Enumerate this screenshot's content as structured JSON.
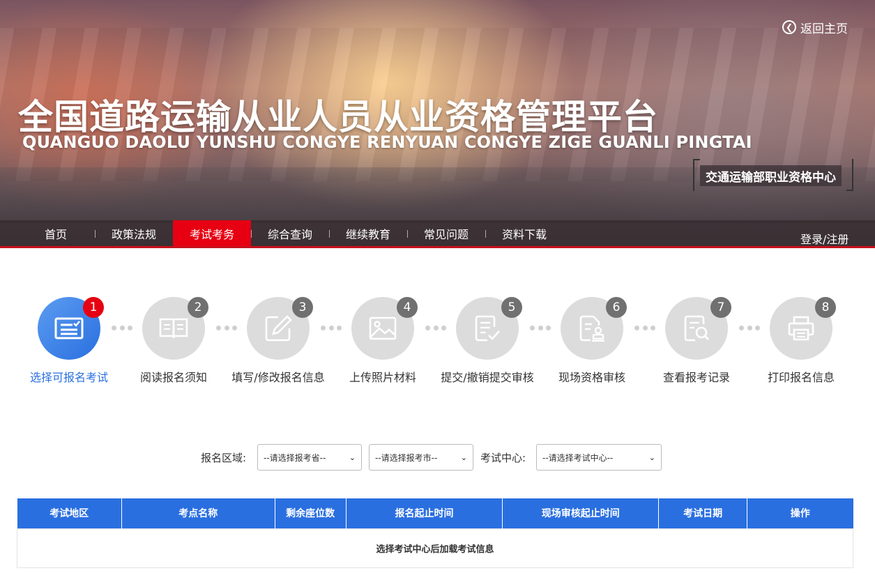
{
  "header": {
    "home_link": "返回主页",
    "title_cn": "全国道路运输从业人员从业资格管理平台",
    "title_en": "QUANGUO DAOLU YUNSHU CONGYE RENYUAN CONGYE ZIGE GUANLI PINGTAI",
    "org": "交通运输部职业资格中心"
  },
  "nav": {
    "items": [
      "首页",
      "政策法规",
      "考试考务",
      "综合查询",
      "继续教育",
      "常见问题",
      "资料下载"
    ],
    "active_index": 2,
    "login": "登录/注册"
  },
  "steps": [
    {
      "num": "1",
      "label": "选择可报名考试",
      "icon": "exam-list-icon"
    },
    {
      "num": "2",
      "label": "阅读报名须知",
      "icon": "book-icon"
    },
    {
      "num": "3",
      "label": "填写/修改报名信息",
      "icon": "edit-icon"
    },
    {
      "num": "4",
      "label": "上传照片材料",
      "icon": "image-icon"
    },
    {
      "num": "5",
      "label": "提交/撤销提交审核",
      "icon": "submit-doc-icon"
    },
    {
      "num": "6",
      "label": "现场资格审核",
      "icon": "stamp-doc-icon"
    },
    {
      "num": "7",
      "label": "查看报考记录",
      "icon": "search-doc-icon"
    },
    {
      "num": "8",
      "label": "打印报名信息",
      "icon": "printer-icon"
    }
  ],
  "filters": {
    "region_label": "报名区域:",
    "province_selected": "--请选择报考省--",
    "city_selected": "--请选择报考市--",
    "center_label": "考试中心:",
    "center_selected": "--请选择考试中心--"
  },
  "table": {
    "headers": [
      "考试地区",
      "考点名称",
      "剩余座位数",
      "报名起止时间",
      "现场审核起止时间",
      "考试日期",
      "操作"
    ],
    "empty_message": "选择考试中心后加载考试信息"
  },
  "colors": {
    "accent_blue": "#2a6fe0",
    "accent_red": "#e60012",
    "inactive_gray": "#dcdcdc"
  }
}
